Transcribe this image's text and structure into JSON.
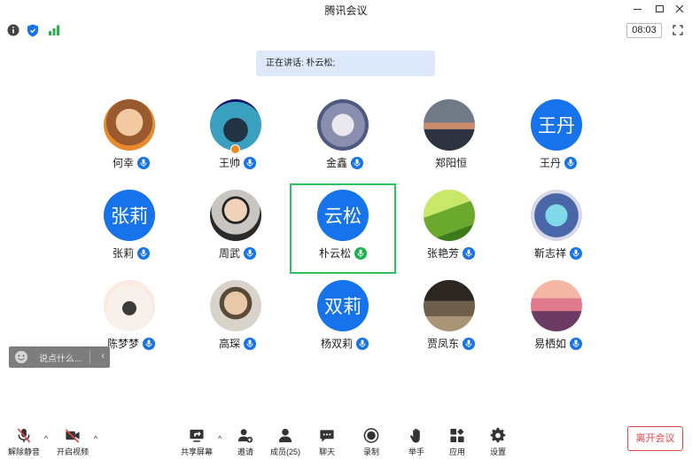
{
  "window": {
    "title": "腾讯会议"
  },
  "toolbar": {
    "timer": "08:03"
  },
  "speaking": {
    "text": "正在讲话: 朴云松;"
  },
  "participants": [
    {
      "name": "何幸",
      "avatar_type": "photo",
      "avatar_text": "",
      "mic": "blue"
    },
    {
      "name": "王帅",
      "avatar_type": "photo",
      "avatar_text": "",
      "mic": "blue",
      "host": true
    },
    {
      "name": "金鑫",
      "avatar_type": "photo",
      "avatar_text": "",
      "mic": "blue"
    },
    {
      "name": "郑阳恒",
      "avatar_type": "photo",
      "avatar_text": "",
      "mic": "none"
    },
    {
      "name": "王丹",
      "avatar_type": "text",
      "avatar_text": "王丹",
      "mic": "blue"
    },
    {
      "name": "张莉",
      "avatar_type": "text",
      "avatar_text": "张莉",
      "mic": "blue"
    },
    {
      "name": "周武",
      "avatar_type": "photo",
      "avatar_text": "",
      "mic": "blue"
    },
    {
      "name": "朴云松",
      "avatar_type": "text",
      "avatar_text": "云松",
      "mic": "green",
      "active": true
    },
    {
      "name": "张艳芳",
      "avatar_type": "photo",
      "avatar_text": "",
      "mic": "blue"
    },
    {
      "name": "靳志祥",
      "avatar_type": "photo",
      "avatar_text": "",
      "mic": "blue"
    },
    {
      "name": "陈梦梦",
      "avatar_type": "photo",
      "avatar_text": "",
      "mic": "blue"
    },
    {
      "name": "高琛",
      "avatar_type": "photo",
      "avatar_text": "",
      "mic": "blue"
    },
    {
      "name": "杨双莉",
      "avatar_type": "text",
      "avatar_text": "双莉",
      "mic": "blue"
    },
    {
      "name": "贾凤东",
      "avatar_type": "photo",
      "avatar_text": "",
      "mic": "blue"
    },
    {
      "name": "易栖如",
      "avatar_type": "photo",
      "avatar_text": "",
      "mic": "blue"
    }
  ],
  "chat": {
    "placeholder": "说点什么..."
  },
  "bottom": {
    "unmute": "解除静音",
    "video": "开启视频",
    "share": "共享屏幕",
    "invite": "邀请",
    "members": "成员(25)",
    "chat": "聊天",
    "record": "录制",
    "raise_hand": "举手",
    "apps": "应用",
    "settings": "设置",
    "leave": "离开会议"
  },
  "colors": {
    "accent": "#1673ec",
    "active_border": "#2fbf5f",
    "leave": "#e04646"
  }
}
